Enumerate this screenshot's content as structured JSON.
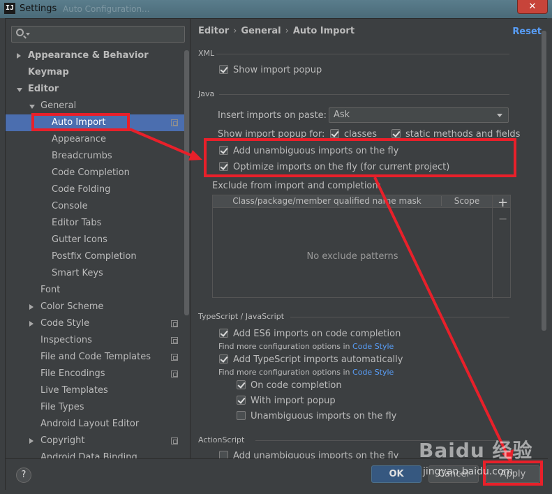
{
  "window": {
    "icon_letter": "IJ",
    "title": "Settings",
    "ghost_title": "Auto Configuration...",
    "close_label": "✕"
  },
  "search": {
    "placeholder": ""
  },
  "tree": [
    {
      "label": "Appearance & Behavior",
      "level": 0,
      "arrow": "right",
      "bold": true
    },
    {
      "label": "Keymap",
      "level": 0,
      "arrow": "",
      "bold": true
    },
    {
      "label": "Editor",
      "level": 0,
      "arrow": "down",
      "bold": true
    },
    {
      "label": "General",
      "level": 1,
      "arrow": "down"
    },
    {
      "label": "Auto Import",
      "level": 2,
      "selected": true,
      "project_icon": true
    },
    {
      "label": "Appearance",
      "level": 2
    },
    {
      "label": "Breadcrumbs",
      "level": 2
    },
    {
      "label": "Code Completion",
      "level": 2
    },
    {
      "label": "Code Folding",
      "level": 2
    },
    {
      "label": "Console",
      "level": 2
    },
    {
      "label": "Editor Tabs",
      "level": 2
    },
    {
      "label": "Gutter Icons",
      "level": 2
    },
    {
      "label": "Postfix Completion",
      "level": 2
    },
    {
      "label": "Smart Keys",
      "level": 2
    },
    {
      "label": "Font",
      "level": 1
    },
    {
      "label": "Color Scheme",
      "level": 1,
      "arrow": "right"
    },
    {
      "label": "Code Style",
      "level": 1,
      "arrow": "right",
      "project_icon": true
    },
    {
      "label": "Inspections",
      "level": 1,
      "project_icon": true
    },
    {
      "label": "File and Code Templates",
      "level": 1,
      "project_icon": true
    },
    {
      "label": "File Encodings",
      "level": 1,
      "project_icon": true
    },
    {
      "label": "Live Templates",
      "level": 1
    },
    {
      "label": "File Types",
      "level": 1
    },
    {
      "label": "Android Layout Editor",
      "level": 1
    },
    {
      "label": "Copyright",
      "level": 1,
      "arrow": "right",
      "project_icon": true
    },
    {
      "label": "Android Data Binding",
      "level": 1
    }
  ],
  "breadcrumb": [
    "Editor",
    "General",
    "Auto Import"
  ],
  "reset_label": "Reset",
  "xml": {
    "title": "XML",
    "show_import_popup": {
      "label": "Show import popup",
      "checked": true
    }
  },
  "java": {
    "title": "Java",
    "insert_label": "Insert imports on paste:",
    "insert_value": "Ask",
    "show_popup_label": "Show import popup for:",
    "classes": {
      "label": "classes",
      "checked": true
    },
    "static_methods": {
      "label": "static methods and fields",
      "checked": true
    },
    "add_unambiguous": {
      "label": "Add unambiguous imports on the fly",
      "checked": true
    },
    "optimize": {
      "label": "Optimize imports on the fly (for current project)",
      "checked": true
    },
    "exclude_label": "Exclude from import and completion:",
    "table": {
      "col1": "Class/package/member qualified name mask",
      "col2": "Scope",
      "empty": "No exclude patterns",
      "add": "+",
      "remove": "−"
    }
  },
  "typescript": {
    "title": "TypeScript / JavaScript",
    "es6": {
      "label": "Add ES6 imports on code completion",
      "checked": true
    },
    "hint_prefix": "Find more configuration options in",
    "hint_link": "Code Style",
    "ts_auto": {
      "label": "Add TypeScript imports automatically",
      "checked": true
    },
    "on_completion": {
      "label": "On code completion",
      "checked": true
    },
    "with_popup": {
      "label": "With import popup",
      "checked": true
    },
    "unambiguous": {
      "label": "Unambiguous imports on the fly",
      "checked": false
    }
  },
  "actionscript": {
    "title": "ActionScript",
    "add_unambiguous": {
      "label": "Add unambiguous imports on the fly",
      "checked": false
    }
  },
  "buttons": {
    "help": "?",
    "ok": "OK",
    "cancel": "Cancel",
    "apply": "Apply"
  },
  "watermark": {
    "brand": "Baidu 经验",
    "site": "jingyan.baidu.com"
  },
  "annotation_color": "#e8202a"
}
